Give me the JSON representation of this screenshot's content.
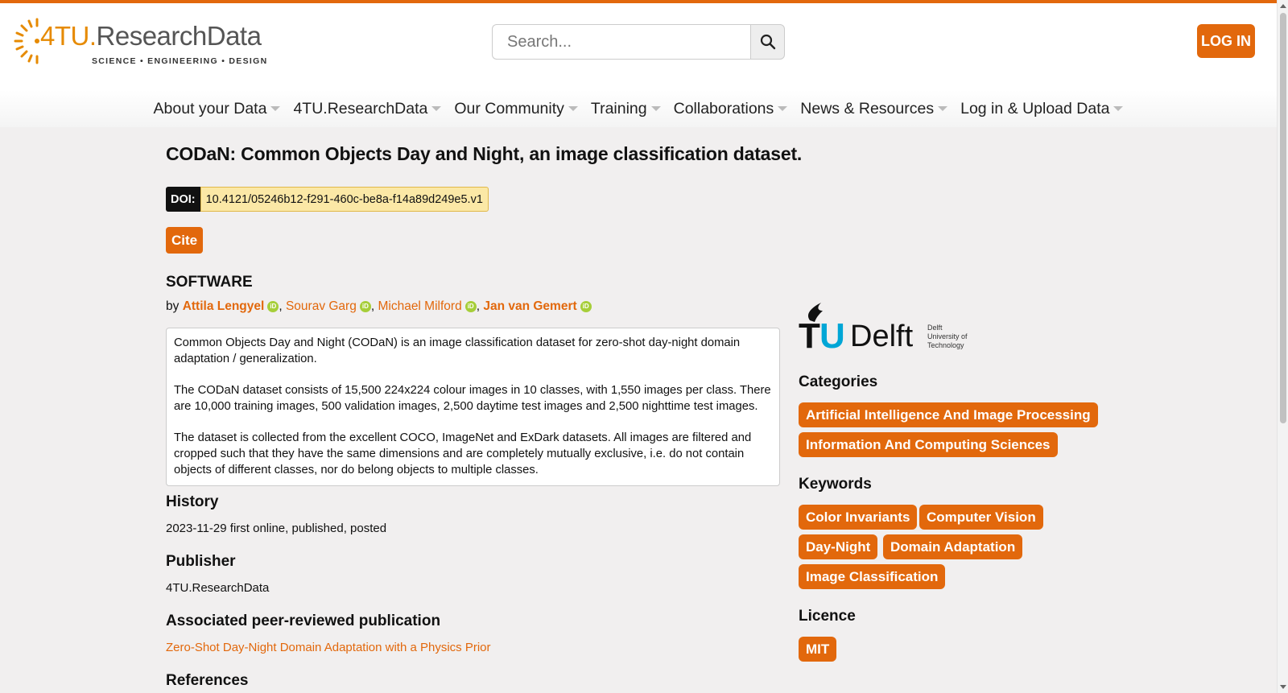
{
  "brand": {
    "name_part1": "4TU.",
    "name_part2": "ResearchData",
    "tagline": "SCIENCE • ENGINEERING • DESIGN",
    "accent": "#e2680c"
  },
  "search": {
    "placeholder": "Search...",
    "icon": "search-icon"
  },
  "header": {
    "login_label": "LOG IN"
  },
  "nav": [
    {
      "label": "About your Data"
    },
    {
      "label": "4TU.ResearchData"
    },
    {
      "label": "Our Community"
    },
    {
      "label": "Training"
    },
    {
      "label": "Collaborations"
    },
    {
      "label": "News & Resources"
    },
    {
      "label": "Log in & Upload Data"
    }
  ],
  "dataset": {
    "title": "CODaN: Common Objects Day and Night, an image classification dataset.",
    "doi_label": "DOI:",
    "doi": "10.4121/05246b12-f291-460c-be8a-f14a89d249e5.v1",
    "cite_label": "Cite",
    "type": "SOFTWARE",
    "by": "by",
    "authors": [
      {
        "name": "Attila Lengyel"
      },
      {
        "name": "Sourav Garg"
      },
      {
        "name": "Michael Milford"
      },
      {
        "name": "Jan van Gemert"
      }
    ],
    "description": [
      "Common Objects Day and Night (CODaN) is an image classification dataset for zero-shot day-night domain adaptation / generalization.",
      "The CODaN dataset consists of 15,500 224x224 colour images in 10 classes, with 1,550 images per class. There are 10,000 training images, 500 validation images, 2,500 daytime test images and 2,500 nighttime test images.",
      "The dataset is collected from the excellent COCO, ImageNet and ExDark datasets. All images are filtered and cropped such that they have the same dimensions and are completely mutually exclusive, i.e. do not contain objects of different classes, nor do belong objects to multiple classes."
    ],
    "history_heading": "History",
    "history": "2023-11-29 first online, published, posted",
    "publisher_heading": "Publisher",
    "publisher": "4TU.ResearchData",
    "publication_heading": "Associated peer-reviewed publication",
    "publication": "Zero-Shot Day-Night Domain Adaptation with a Physics Prior",
    "references_heading": "References"
  },
  "sidebar": {
    "institution": {
      "tu": "TU",
      "delft": "Delft",
      "sub1": "Delft",
      "sub2": "University of",
      "sub3": "Technology"
    },
    "categories_heading": "Categories",
    "categories": [
      "Artificial Intelligence And Image Processing",
      "Information And Computing Sciences"
    ],
    "keywords_heading": "Keywords",
    "keywords": [
      "Color Invariants",
      "Computer Vision",
      "Day-Night",
      "Domain Adaptation",
      "Image Classification"
    ],
    "licence_heading": "Licence",
    "licence": "MIT"
  }
}
